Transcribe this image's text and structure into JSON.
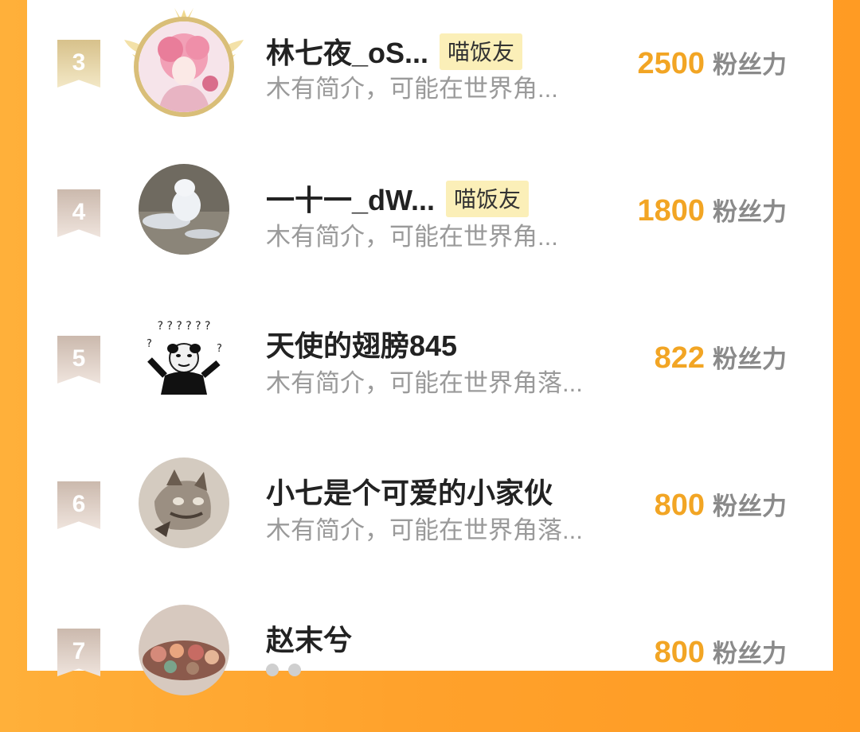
{
  "score_unit": "粉丝力",
  "users": [
    {
      "rank": "3",
      "name": "林七夜_oS...",
      "badge": "喵饭友",
      "intro": "木有简介，可能在世界角...",
      "score": "2500"
    },
    {
      "rank": "4",
      "name": "一十一_dW...",
      "badge": "喵饭友",
      "intro": "木有简介，可能在世界角...",
      "score": "1800"
    },
    {
      "rank": "5",
      "name": "天使的翅膀845",
      "intro": "木有简介，可能在世界角落...",
      "score": "822"
    },
    {
      "rank": "6",
      "name": "小七是个可爱的小家伙",
      "intro": "木有简介，可能在世界角落...",
      "score": "800"
    },
    {
      "rank": "7",
      "name": "赵末兮",
      "score": "800"
    }
  ],
  "colors": {
    "background": "#ffa12b",
    "score": "#f2a524",
    "badge_bg": "#fbefb8",
    "rank_gold": "#d7c18b",
    "rank_plain": "#cbb9ad"
  }
}
